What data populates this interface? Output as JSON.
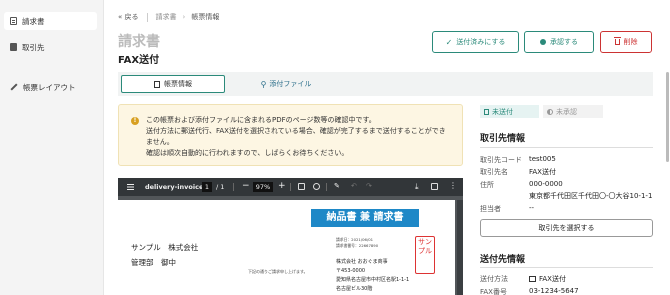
{
  "sidebar": {
    "items": [
      {
        "label": "請求書",
        "icon": "document-icon"
      },
      {
        "label": "取引先",
        "icon": "book-icon"
      },
      {
        "label": "帳票レイアウト",
        "icon": "pen-icon"
      }
    ]
  },
  "breadcrumb": {
    "back": "戻る",
    "parent": "請求書",
    "current": "帳票情報"
  },
  "header": {
    "doc_type": "請求書",
    "title": "FAX送付"
  },
  "actions": {
    "sent": "送付済みにする",
    "approve": "承認する",
    "delete": "削除"
  },
  "tabs": [
    {
      "label": "帳票情報"
    },
    {
      "label": "添付ファイル"
    }
  ],
  "notice": {
    "lines": [
      "この帳票および添付ファイルに含まれるPDFのページ数等の確認中です。",
      "送付方法に郵送代行、FAX送付を選択されている場合、確認が完了するまで送付することができ",
      "ません。",
      "確認は順次自動的に行われますので、しばらくお待ちください。"
    ]
  },
  "pdf_viewer": {
    "filename": "delivery-invoice",
    "page": "1",
    "page_total": "/ 1",
    "zoom": "97%",
    "page_content": {
      "heading": "納品書 兼 請求書",
      "customer": "サンプル　株式会社",
      "customer_dept": "管理部　御中",
      "note": "下記の通りご請求申し上げます。",
      "issue_date": "請求日：2021/06/01",
      "invoice_no": "請求書番号：22667890",
      "issuer": "株式会社 おおぐま商事",
      "zip": "〒453-0000",
      "address1": "愛知県名古屋市中村区名駅1-1-1",
      "address2": "名古屋ビル30階",
      "seal": "サンプル"
    }
  },
  "status": {
    "sent": "未送付",
    "approval": "未承認"
  },
  "partner": {
    "section_title": "取引先情報",
    "rows": [
      {
        "key": "取引先コード",
        "value": "test005"
      },
      {
        "key": "取引先名",
        "value": "FAX送付"
      },
      {
        "key": "住所",
        "value": "000-0000"
      },
      {
        "key": "",
        "value": "東京都千代田区千代田〇-〇大谷10-1-1"
      },
      {
        "key": "担当者",
        "value": "--"
      }
    ],
    "select_button": "取引先を選択する"
  },
  "sending": {
    "section_title": "送付先情報",
    "rows": [
      {
        "key": "送付方法",
        "value": "FAX送付"
      },
      {
        "key": "FAX番号",
        "value": "03-1234-5647"
      }
    ]
  },
  "colors": {
    "accent": "#2b8a7a",
    "danger": "#cc3333",
    "notice_bg": "#fdf6e3",
    "pdf_header": "#1e88c7"
  }
}
